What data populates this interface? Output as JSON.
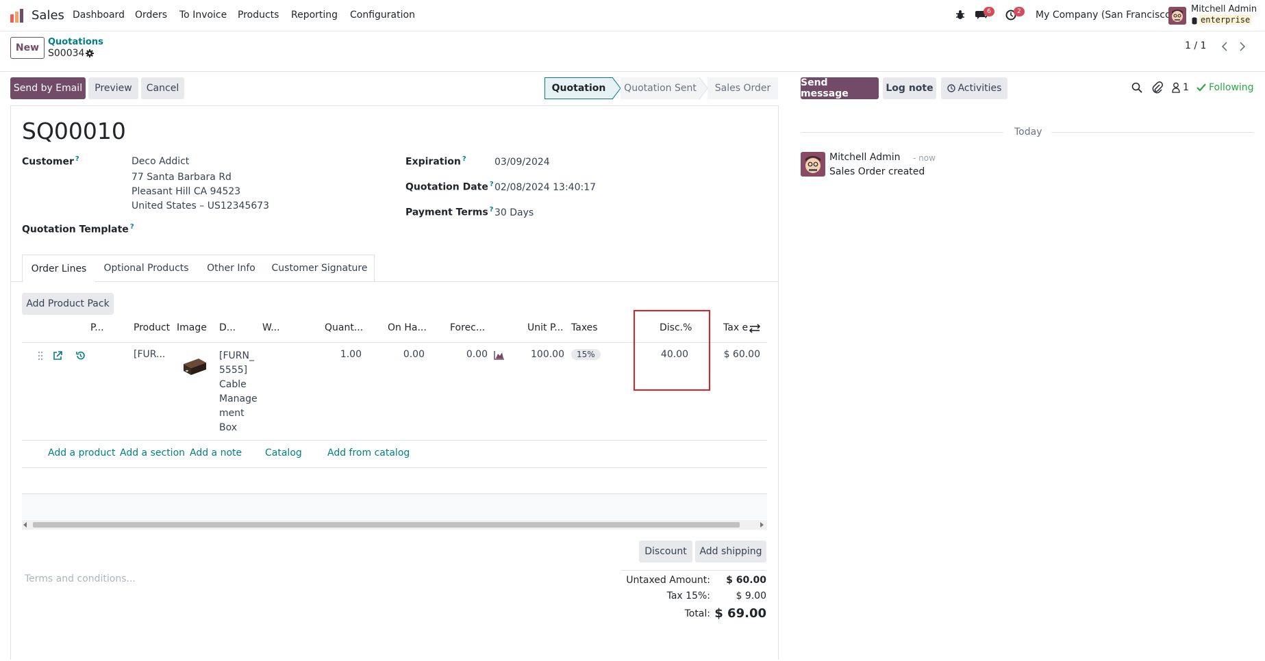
{
  "navbar": {
    "app_name": "Sales",
    "menu": [
      "Dashboard",
      "Orders",
      "To Invoice",
      "Products",
      "Reporting",
      "Configuration"
    ],
    "messages_count": "6",
    "activities_count": "2",
    "company": "My Company (San Francisco)",
    "user_name": "Mitchell Admin",
    "db_name": "enterprise"
  },
  "control": {
    "new_label": "New",
    "breadcrumb_parent": "Quotations",
    "record_ref": "S00034",
    "pager": "1 / 1"
  },
  "actions": {
    "send_email": "Send by Email",
    "preview": "Preview",
    "cancel": "Cancel"
  },
  "status": {
    "steps": [
      "Quotation",
      "Quotation Sent",
      "Sales Order"
    ],
    "active_index": 0
  },
  "form": {
    "title": "SQ00010",
    "customer_label": "Customer",
    "customer_name": "Deco Addict",
    "customer_addr1": "77 Santa Barbara Rd",
    "customer_addr2": "Pleasant Hill CA 94523",
    "customer_addr3": "United States – US12345673",
    "template_label": "Quotation Template",
    "expiration_label": "Expiration",
    "expiration_value": "03/09/2024",
    "qdate_label": "Quotation Date",
    "qdate_value": "02/08/2024 13:40:17",
    "terms_label": "Payment Terms",
    "terms_value": "30 Days"
  },
  "tabs": [
    "Order Lines",
    "Optional Products",
    "Other Info",
    "Customer Signature"
  ],
  "lines": {
    "add_pack": "Add Product Pack",
    "headers": {
      "p": "P...",
      "product": "Product",
      "image": "Image",
      "desc": "D...",
      "w": "W...",
      "qty": "Quant...",
      "onhand": "On Ha...",
      "forecast": "Forec...",
      "unit_price": "Unit P...",
      "taxes": "Taxes",
      "disc": "Disc.%",
      "tax_excl": "Tax e"
    },
    "row": {
      "product": "[FUR...",
      "desc_lines": [
        "[FURN_",
        "5555]",
        "Cable",
        "Manage",
        "ment",
        "Box"
      ],
      "qty": "1.00",
      "onhand": "0.00",
      "forecast": "0.00",
      "unit_price": "100.00",
      "tax": "15%",
      "disc": "40.00",
      "subtotal": "$ 60.00"
    },
    "add_links": [
      "Add a product",
      "Add a section",
      "Add a note",
      "Catalog",
      "Add from catalog"
    ]
  },
  "footer": {
    "discount_btn": "Discount",
    "shipping_btn": "Add shipping",
    "terms_placeholder": "Terms and conditions...",
    "untaxed_label": "Untaxed Amount:",
    "untaxed_value": "$ 60.00",
    "tax_label": "Tax 15%:",
    "tax_value": "$ 9.00",
    "total_label": "Total:",
    "total_value": "$ 69.00"
  },
  "chatter": {
    "send_message": "Send message",
    "log_note": "Log note",
    "activities": "Activities",
    "followers_count": "1",
    "following": "Following",
    "date_sep": "Today",
    "author": "Mitchell Admin",
    "time": "- now",
    "message": "Sales Order created"
  },
  "colors": {
    "brand": "#714b67",
    "link": "#017e84",
    "highlight": "#e02020",
    "success": "#28a745"
  }
}
